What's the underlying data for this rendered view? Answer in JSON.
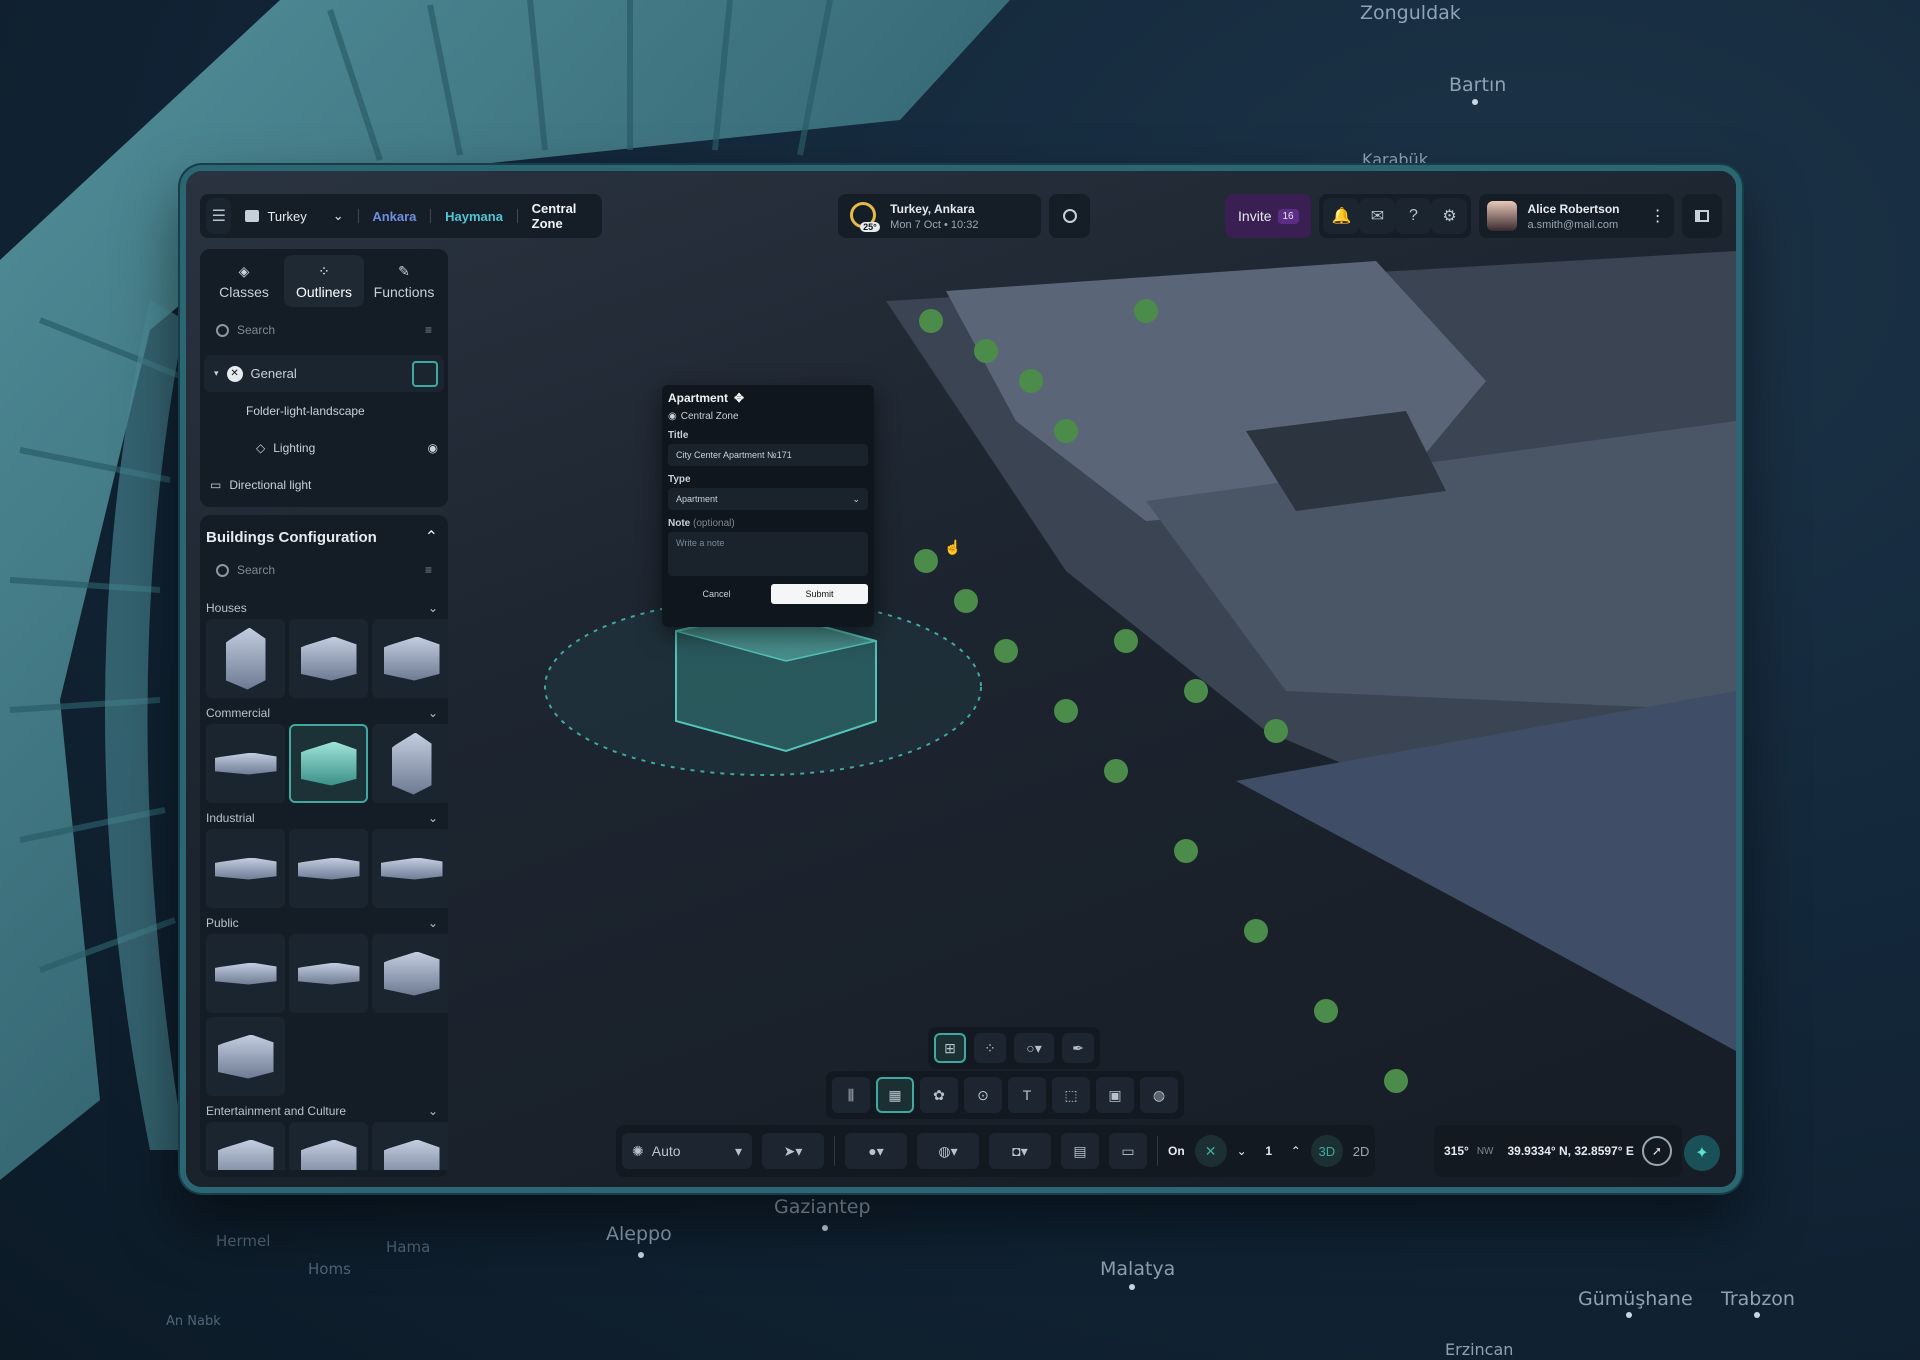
{
  "map_labels": {
    "zonguldak": "Zonguldak",
    "bartin": "Bartın",
    "karabuk": "Karabük",
    "gaziantep": "Gaziantep",
    "aleppo": "Aleppo",
    "hama": "Hama",
    "homs": "Homs",
    "hermel": "Hermel",
    "an_nabk": "An Nabk",
    "malatya": "Malatya",
    "gumushane": "Gümüşhane",
    "trabzon": "Trabzon",
    "erzincan": "Erzincan"
  },
  "topbar": {
    "country": "Turkey",
    "breadcrumb": [
      "Ankara",
      "Haymana",
      "Central Zone"
    ],
    "weather": {
      "location": "Turkey, Ankara",
      "temp": "25°",
      "date": "Mon 7 Oct",
      "time": "10:32"
    },
    "invite_label": "Invite",
    "invite_count": "16",
    "user": {
      "name": "Alice Robertson",
      "email": "a.smith@mail.com"
    }
  },
  "left_tabs": [
    {
      "label": "Classes",
      "icon": "layers-icon"
    },
    {
      "label": "Outliners",
      "icon": "grid-icon"
    },
    {
      "label": "Functions",
      "icon": "pen-icon"
    }
  ],
  "outliner": {
    "search_placeholder": "Search",
    "general": "General",
    "folder": "Folder-light-landscape",
    "lighting": "Lighting",
    "directional": "Directional light"
  },
  "buildings": {
    "title": "Buildings Configuration",
    "search_placeholder": "Search",
    "categories": [
      "Houses",
      "Commercial",
      "Industrial",
      "Public",
      "Entertainment and Culture"
    ]
  },
  "popup": {
    "title": "Apartment",
    "zone": "Central Zone",
    "title_label": "Title",
    "title_value": "City Center Apartment №171",
    "type_label": "Type",
    "type_value": "Apartment",
    "note_label": "Note",
    "note_optional": "(optional)",
    "note_placeholder": "Write a note",
    "cancel": "Cancel",
    "submit": "Submit"
  },
  "bottom": {
    "mode": "Auto",
    "toggle": "On",
    "level": "1",
    "view_3d": "3D",
    "view_2d": "2D"
  },
  "status": {
    "heading": "315°",
    "heading_dir": "NW",
    "coords": "39.9334° N, 32.8597° E"
  },
  "colors": {
    "accent": "#3fa8a0",
    "invite_bg": "#3a1f52",
    "frame": "#2b6673"
  }
}
